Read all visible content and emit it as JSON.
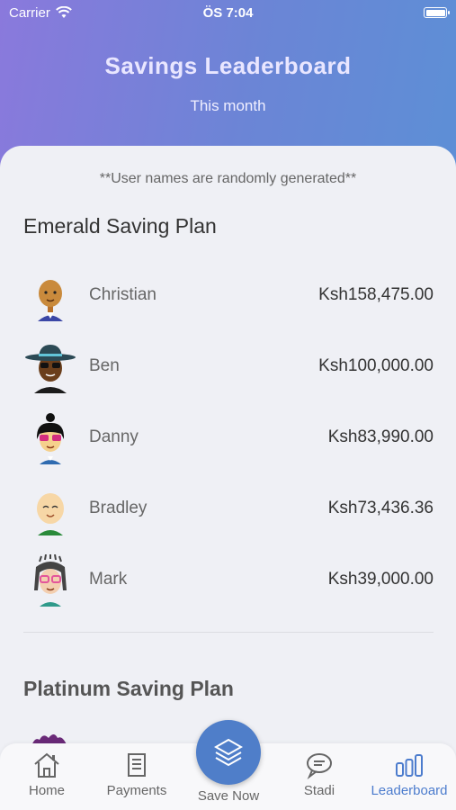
{
  "status_bar": {
    "carrier": "Carrier",
    "time": "ÖS 7:04"
  },
  "header": {
    "title": "Savings Leaderboard",
    "subtitle": "This month"
  },
  "note": "**User names are randomly generated**",
  "plans": [
    {
      "title": "Emerald Saving Plan",
      "entries": [
        {
          "name": "Christian",
          "amount": "Ksh158,475.00"
        },
        {
          "name": "Ben",
          "amount": "Ksh100,000.00"
        },
        {
          "name": "Danny",
          "amount": "Ksh83,990.00"
        },
        {
          "name": "Bradley",
          "amount": "Ksh73,436.36"
        },
        {
          "name": "Mark",
          "amount": "Ksh39,000.00"
        }
      ]
    },
    {
      "title": "Platinum Saving Plan"
    }
  ],
  "tabs": [
    {
      "label": "Home",
      "icon": "home-icon"
    },
    {
      "label": "Payments",
      "icon": "receipt-icon"
    },
    {
      "label": "Save Now",
      "icon": "layers-icon"
    },
    {
      "label": "Stadi",
      "icon": "chat-icon"
    },
    {
      "label": "Leaderboard",
      "icon": "bar-chart-icon"
    }
  ],
  "colors": {
    "accent": "#4f7ec9",
    "header_start": "#8a79dc",
    "header_end": "#5d8fd6"
  }
}
